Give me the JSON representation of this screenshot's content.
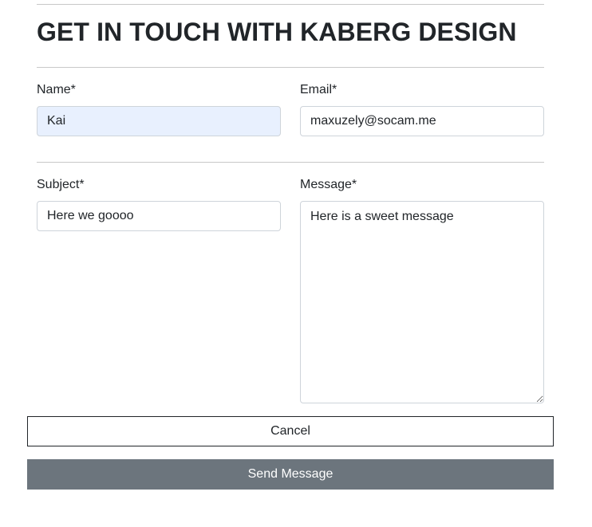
{
  "form": {
    "title": "GET IN TOUCH WITH KABERG DESIGN",
    "name": {
      "label": "Name*",
      "value": "Kai"
    },
    "email": {
      "label": "Email*",
      "value": "maxuzely@socam.me"
    },
    "subject": {
      "label": "Subject*",
      "value": "Here we goooo"
    },
    "message": {
      "label": "Message*",
      "value": "Here is a sweet message"
    },
    "cancel_label": "Cancel",
    "send_label": "Send Message"
  },
  "colors": {
    "autofill_background": "#e8f0fe",
    "send_button_background": "#6c757d",
    "send_button_text": "#ffffff"
  }
}
